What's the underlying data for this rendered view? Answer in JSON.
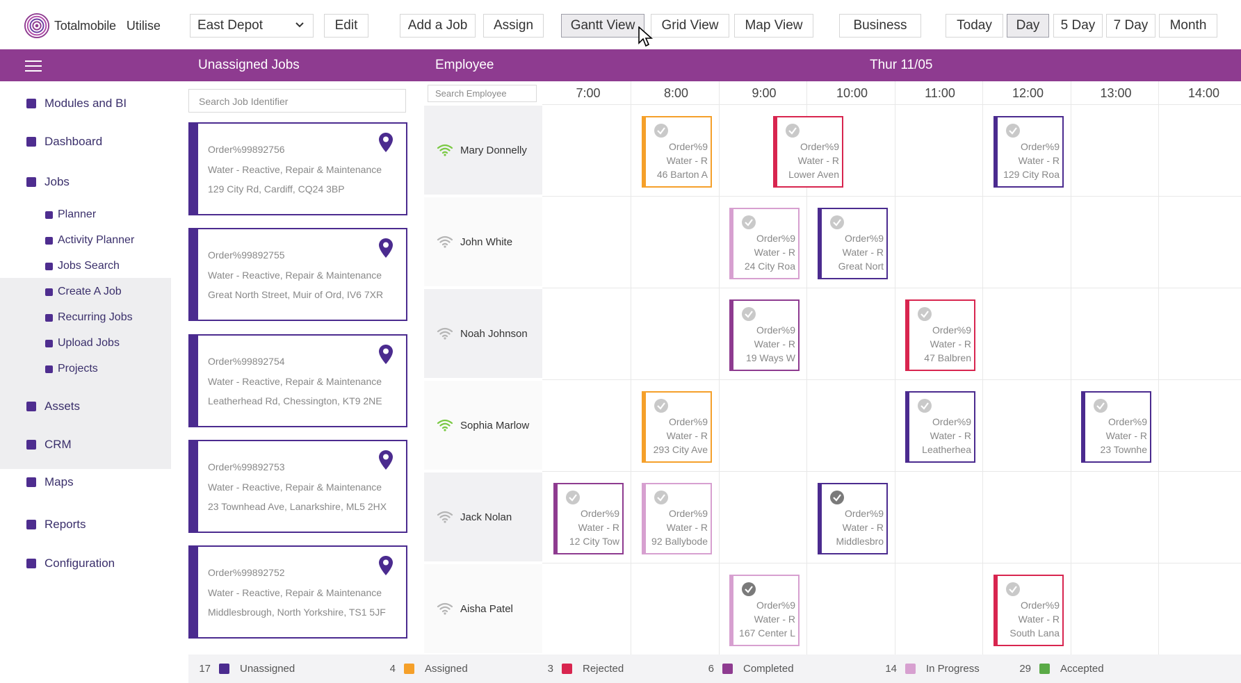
{
  "header": {
    "brand": "Totalmobile",
    "product": "Utilise",
    "depot_select": "East Depot",
    "buttons": {
      "edit": "Edit",
      "add_job": "Add a Job",
      "assign": "Assign",
      "gantt": "Gantt View",
      "grid": "Grid View",
      "map": "Map View",
      "business": "Business",
      "today": "Today",
      "day": "Day",
      "five_day": "5 Day",
      "seven_day": "7 Day",
      "month": "Month"
    },
    "active_buttons": [
      "gantt",
      "day"
    ]
  },
  "bar": {
    "unassigned_title": "Unassigned Jobs",
    "employee_title": "Employee",
    "date": "Thur 11/05"
  },
  "sidebar": {
    "items": [
      {
        "label": "Modules and BI"
      },
      {
        "label": "Dashboard"
      },
      {
        "label": "Jobs"
      },
      {
        "label": "Assets"
      },
      {
        "label": "CRM"
      },
      {
        "label": "Maps"
      },
      {
        "label": "Reports"
      },
      {
        "label": "Configuration"
      }
    ],
    "jobs_sub": [
      {
        "label": "Planner"
      },
      {
        "label": "Activity Planner"
      },
      {
        "label": "Jobs Search"
      },
      {
        "label": "Create A Job"
      },
      {
        "label": "Recurring Jobs"
      },
      {
        "label": "Upload Jobs"
      },
      {
        "label": "Projects"
      }
    ]
  },
  "unassigned": {
    "search_placeholder": "Search Job Identifier",
    "jobs": [
      {
        "order": "Order%99892756",
        "type": "Water - Reactive, Repair & Maintenance",
        "address": "129 City Rd, Cardiff, CQ24 3BP"
      },
      {
        "order": "Order%99892755",
        "type": "Water - Reactive, Repair & Maintenance",
        "address": "Great North Street, Muir of Ord, IV6 7XR"
      },
      {
        "order": "Order%99892754",
        "type": "Water - Reactive, Repair & Maintenance",
        "address": "Leatherhead Rd, Chessington, KT9 2NE"
      },
      {
        "order": "Order%99892753",
        "type": "Water - Reactive, Repair & Maintenance",
        "address": "23 Townhead Ave, Lanarkshire, ML5 2HX"
      },
      {
        "order": "Order%99892752",
        "type": "Water - Reactive, Repair & Maintenance",
        "address": "Middlesbrough, North Yorkshire, TS1 5JF"
      }
    ]
  },
  "gantt": {
    "search_placeholder": "Search Employee",
    "hours": [
      "7:00",
      "8:00",
      "9:00",
      "10:00",
      "11:00",
      "12:00",
      "13:00",
      "14:00"
    ],
    "employees": [
      {
        "name": "Mary Donnelly",
        "online": true
      },
      {
        "name": "John White",
        "online": false
      },
      {
        "name": "Noah Johnson",
        "online": false
      },
      {
        "name": "Sophia Marlow",
        "online": true
      },
      {
        "name": "Jack Nolan",
        "online": false
      },
      {
        "name": "Aisha  Patel",
        "online": false
      }
    ],
    "jobs": [
      {
        "row": 0,
        "start": "8:00",
        "status": "assigned",
        "l1": "Order%9",
        "l2": "Water - R",
        "l3": "46 Barton A"
      },
      {
        "row": 0,
        "start": "9:30",
        "status": "rejected",
        "l1": "Order%9",
        "l2": "Water - R",
        "l3": "Lower Aven"
      },
      {
        "row": 0,
        "start": "12:00",
        "status": "unassigned",
        "l1": "Order%9",
        "l2": "Water - R",
        "l3": "129 City Roa"
      },
      {
        "row": 1,
        "start": "9:00",
        "status": "in_progress",
        "l1": "Order%9",
        "l2": "Water - R",
        "l3": "24 City Roa"
      },
      {
        "row": 1,
        "start": "10:00",
        "status": "unassigned",
        "l1": "Order%9",
        "l2": "Water - R",
        "l3": "Great Nort"
      },
      {
        "row": 2,
        "start": "9:00",
        "status": "completed",
        "l1": "Order%9",
        "l2": "Water - R",
        "l3": "19 Ways W"
      },
      {
        "row": 2,
        "start": "11:00",
        "status": "rejected",
        "l1": "Order%9",
        "l2": "Water - R",
        "l3": "47 Balbren"
      },
      {
        "row": 3,
        "start": "8:00",
        "status": "assigned",
        "l1": "Order%9",
        "l2": "Water - R",
        "l3": "293 City Ave"
      },
      {
        "row": 3,
        "start": "11:00",
        "status": "unassigned",
        "l1": "Order%9",
        "l2": "Water - R",
        "l3": "Leatherhea"
      },
      {
        "row": 3,
        "start": "13:00",
        "status": "unassigned",
        "l1": "Order%9",
        "l2": "Water - R",
        "l3": "23 Townhe"
      },
      {
        "row": 4,
        "start": "7:00",
        "status": "completed",
        "l1": "Order%9",
        "l2": "Water - R",
        "l3": "12 City Tow"
      },
      {
        "row": 4,
        "start": "8:00",
        "status": "in_progress",
        "l1": "Order%9",
        "l2": "Water - R",
        "l3": "92 Ballybode"
      },
      {
        "row": 4,
        "start": "10:00",
        "status": "unassigned",
        "l1": "Order%9",
        "l2": "Water - R",
        "l3": "Middlesbro"
      },
      {
        "row": 5,
        "start": "9:00",
        "status": "in_progress",
        "l1": "Order%9",
        "l2": "Water - R",
        "l3": "167 Center L"
      },
      {
        "row": 5,
        "start": "12:00",
        "status": "rejected",
        "l1": "Order%9",
        "l2": "Water - R",
        "l3": "South Lana"
      }
    ]
  },
  "legend": [
    {
      "count": "17",
      "label": "Unassigned",
      "color": "#4b2b8f"
    },
    {
      "count": "4",
      "label": "Assigned",
      "color": "#f5a02a"
    },
    {
      "count": "3",
      "label": "Rejected",
      "color": "#d8254f"
    },
    {
      "count": "6",
      "label": "Completed",
      "color": "#8e3b90"
    },
    {
      "count": "14",
      "label": "In Progress",
      "color": "#d7a0d0"
    },
    {
      "count": "29",
      "label": "Accepted",
      "color": "#5aaa47"
    }
  ],
  "status_colors": {
    "unassigned": "#4b2b8f",
    "assigned": "#f5a02a",
    "rejected": "#d8254f",
    "completed": "#8e3b90",
    "in_progress": "#d7a0d0"
  },
  "colors": {
    "brand_purple": "#8e3b90",
    "nav_purple": "#4e2d8f",
    "wifi_online": "#7ac943",
    "wifi_offline": "#b5b5b5"
  }
}
